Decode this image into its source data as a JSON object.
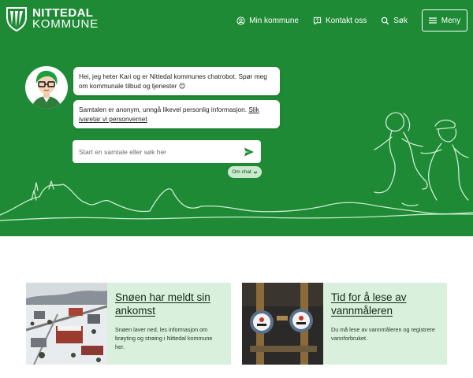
{
  "header": {
    "logo_line1": "NITTEDAL",
    "logo_line2": "KOMMUNE",
    "nav": [
      {
        "label": "Min kommune",
        "icon": "user-circle-icon"
      },
      {
        "label": "Kontakt oss",
        "icon": "chat-question-icon"
      },
      {
        "label": "Søk",
        "icon": "search-icon"
      }
    ],
    "menu_label": "Meny"
  },
  "chat": {
    "greeting": "Hei, jeg heter Kari og er Nittedal kommunes chatrobot. Spør meg om kommunale tilbud og tjenester 😊",
    "privacy_text": "Samtalen er anonym, unngå likevel personlig informasjon.",
    "privacy_link": "Slik ivaretar vi personvernet",
    "input_placeholder": "Start en samtale eller søk her",
    "about_label": "Om chat"
  },
  "cards": [
    {
      "title": "Snøen har meldt sin ankomst",
      "text": "Snøen laver ned, les informasjon om brøyting og strøing i Nittedal kommune her."
    },
    {
      "title": "Tid for å lese av vannmåleren",
      "text": "Du må lese av vannmåleren og registrere vannforbruket."
    }
  ],
  "colors": {
    "brand_green": "#1f8a35",
    "card_bg": "#d8f0dc",
    "chip_bg": "#cbe9cf"
  }
}
